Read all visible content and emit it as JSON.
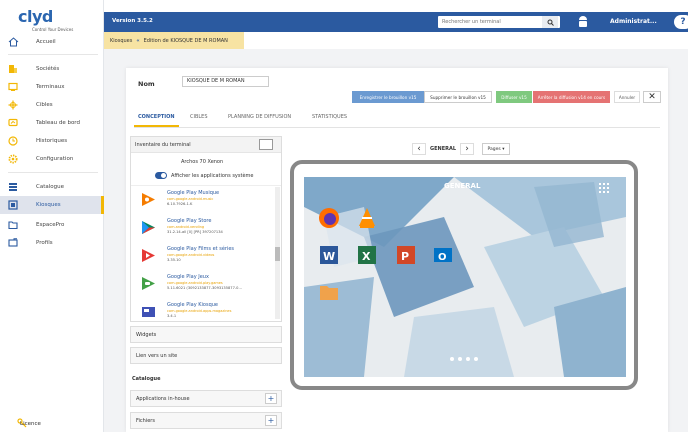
{
  "logo": {
    "text": "clyd",
    "tagline": "Control Your Devices"
  },
  "sidebar": {
    "items": [
      {
        "label": "Accueil",
        "icon": "home-icon"
      },
      {
        "label": "Sociétés",
        "icon": "building-icon"
      },
      {
        "label": "Terminaux",
        "icon": "terminal-icon"
      },
      {
        "label": "Cibles",
        "icon": "target-icon"
      },
      {
        "label": "Tableau de bord",
        "icon": "dashboard-icon"
      },
      {
        "label": "Historiques",
        "icon": "history-icon"
      },
      {
        "label": "Configuration",
        "icon": "gear-icon"
      },
      {
        "label": "Catalogue",
        "icon": "catalog-icon"
      },
      {
        "label": "Kiosques",
        "icon": "kiosk-icon"
      },
      {
        "label": "EspacePro",
        "icon": "folder-icon"
      },
      {
        "label": "Profils",
        "icon": "profile-icon"
      }
    ],
    "licence": "Licence"
  },
  "topbar": {
    "version": "Version 3.5.2",
    "search_placeholder": "Rechercher un terminal",
    "admin": "Administrat...",
    "help": "?"
  },
  "breadcrumb": {
    "parent": "Kiosques",
    "current": "Edition de KIOSQUE DE M ROMAN"
  },
  "form": {
    "name_label": "Nom",
    "name_value": "KIOSQUE DE M ROMAN",
    "buttons": {
      "save_draft": "Enregistrer le brouillon v15",
      "delete_draft": "Supprimer le brouillon v15",
      "publish": "Diffuser v15",
      "stop": "Arrêter la diffusion v14 en cours",
      "cancel": "Annuler"
    }
  },
  "tabs": [
    "CONCEPTION",
    "CIBLES",
    "PLANNING DE DIFFUSION",
    "STATISTIQUES"
  ],
  "inventory": {
    "title": "Inventaire du terminal",
    "device": "Archos 70 Xenon",
    "toggle_label": "Afficher les applications système",
    "apps": [
      {
        "name": "Google Play Musique",
        "package": "com.google.android.music",
        "version": "6.10.7926-1.K",
        "color": "#f57c00"
      },
      {
        "name": "Google Play Store",
        "package": "com.android.vending",
        "version": "31.2.14-all [0] [PR] 397207134",
        "color": "#01875f"
      },
      {
        "name": "Google Play Films et séries",
        "package": "com.google.android.videos",
        "version": "3.35.10",
        "color": "#e53935"
      },
      {
        "name": "Google Play Jeux",
        "package": "com.google.android.play.games",
        "version": "5.11.6021 (3092133877-3093135877-0...",
        "color": "#43a047"
      },
      {
        "name": "Google Play Kiosque",
        "package": "com.google.android.apps.magazines",
        "version": "3.4.1",
        "color": "#3f51b5"
      }
    ]
  },
  "rows": {
    "widgets": "Widgets",
    "web_link": "Lien vers un site"
  },
  "catalogue": {
    "title": "Catalogue",
    "inhouse": "Applications in-house",
    "files": "Fichiers"
  },
  "preview": {
    "page": "GENERAL",
    "pages_btn": "Pages ▾",
    "screen_title": "GENERAL"
  }
}
